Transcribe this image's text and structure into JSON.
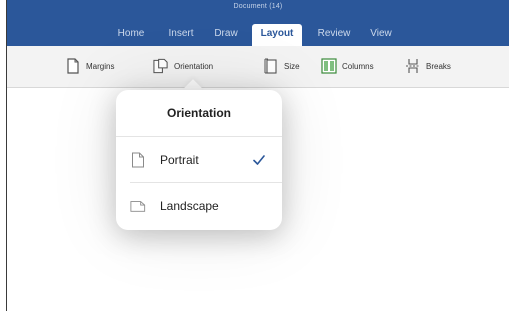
{
  "window": {
    "title": "Document (14)"
  },
  "tabs": [
    {
      "label": "Home"
    },
    {
      "label": "Insert"
    },
    {
      "label": "Draw"
    },
    {
      "label": "Layout"
    },
    {
      "label": "Review"
    },
    {
      "label": "View"
    }
  ],
  "active_tab": "Layout",
  "toolbar": {
    "items": [
      {
        "label": "Margins",
        "icon": "margins-icon"
      },
      {
        "label": "Orientation",
        "icon": "orientation-icon"
      },
      {
        "label": "Size",
        "icon": "size-icon"
      },
      {
        "label": "Columns",
        "icon": "columns-icon"
      },
      {
        "label": "Breaks",
        "icon": "breaks-icon"
      }
    ]
  },
  "popover": {
    "title": "Orientation",
    "options": [
      {
        "label": "Portrait",
        "icon": "portrait-page-icon",
        "selected": true
      },
      {
        "label": "Landscape",
        "icon": "landscape-page-icon",
        "selected": false
      }
    ]
  },
  "colors": {
    "titlebar": "#2b579a",
    "accent": "#2b579a",
    "columns_icon": "#3a8a3a"
  }
}
